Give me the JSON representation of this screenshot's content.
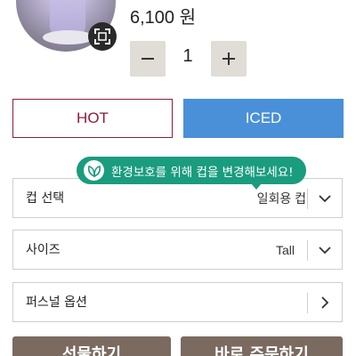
{
  "product": {
    "price": "6,100 원",
    "quantity": "1"
  },
  "temperature": {
    "hot_label": "HOT",
    "iced_label": "ICED",
    "selected": "ICED"
  },
  "eco_tip": {
    "text": "환경보호를 위해 컵을 변경해보세요!"
  },
  "options": {
    "cup": {
      "label": "컵 선택",
      "value": "일회용 컵"
    },
    "size": {
      "label": "사이즈",
      "value": "Tall"
    },
    "personal": {
      "label": "퍼스널 옵션"
    }
  },
  "actions": {
    "gift_label": "선물하기",
    "order_label": "바로 주문하기"
  },
  "colors": {
    "hot_accent": "#8f1c3a",
    "iced_accent": "#4a90d9",
    "eco_green": "#1a9c7e",
    "action_brown": "#7a6a60"
  }
}
